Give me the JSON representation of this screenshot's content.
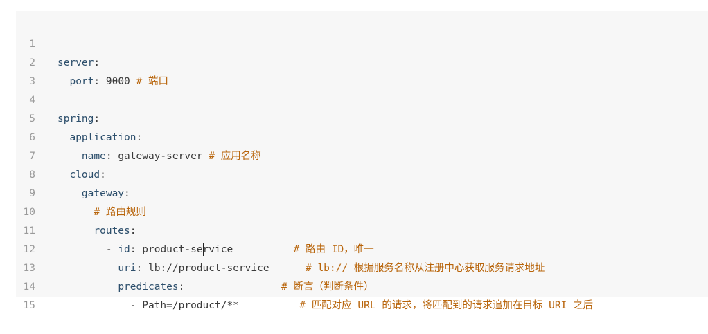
{
  "editor": {
    "lines": [
      {
        "n": "1"
      },
      {
        "n": "2"
      },
      {
        "n": "3"
      },
      {
        "n": "4"
      },
      {
        "n": "5"
      },
      {
        "n": "6"
      },
      {
        "n": "7"
      },
      {
        "n": "8"
      },
      {
        "n": "9"
      },
      {
        "n": "10"
      },
      {
        "n": "11"
      },
      {
        "n": "12"
      },
      {
        "n": "13"
      },
      {
        "n": "14"
      },
      {
        "n": "15"
      }
    ],
    "tokens": {
      "server_key": "server",
      "port_key": "port",
      "port_val": "9000",
      "port_comment_hash": "#",
      "port_comment": "端口",
      "spring_key": "spring",
      "application_key": "application",
      "name_key": "name",
      "name_val": "gateway-server",
      "name_comment_hash": "#",
      "name_comment": "应用名称",
      "cloud_key": "cloud",
      "gateway_key": "gateway",
      "routes_comment_hash": "#",
      "routes_comment": "路由规则",
      "routes_key": "routes",
      "dash": "-",
      "id_key": "id",
      "id_val_a": "product-se",
      "id_val_b": "rvice",
      "id_comment_hash": "#",
      "id_comment_a": "路由",
      "id_comment_b": "ID",
      "id_comment_c": "，唯一",
      "uri_key": "uri",
      "uri_val": "lb://product-service",
      "uri_comment_hash": "#",
      "uri_comment_a": "lb://",
      "uri_comment_b": "根据服务名称从注册中心获取服务请求地址",
      "predicates_key": "predicates",
      "predicates_comment_hash": "#",
      "predicates_comment": "断言（判断条件）",
      "path_item": "- Path=/product/**",
      "path_comment_hash": "#",
      "path_comment_a": "匹配对应",
      "path_comment_b": "URL",
      "path_comment_c": "的请求，将匹配到的请求追加在目标",
      "path_comment_d": "URI",
      "path_comment_e": "之后"
    }
  }
}
